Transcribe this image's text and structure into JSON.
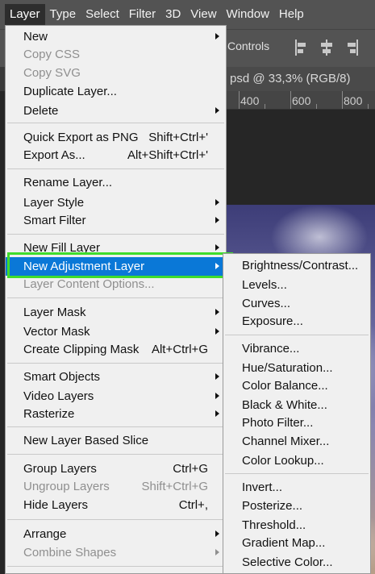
{
  "menubar": {
    "items": [
      {
        "label": "Layer",
        "active": true
      },
      {
        "label": "Type"
      },
      {
        "label": "Select"
      },
      {
        "label": "Filter"
      },
      {
        "label": "3D"
      },
      {
        "label": "View"
      },
      {
        "label": "Window"
      },
      {
        "label": "Help"
      }
    ]
  },
  "options_bar": {
    "controls_label": "Controls"
  },
  "document": {
    "tab_title": "psd @ 33,3% (RGB/8)"
  },
  "ruler": {
    "labels": [
      "400",
      "600",
      "800"
    ]
  },
  "layer_menu": {
    "items": [
      {
        "label": "New",
        "submenu": true
      },
      {
        "label": "Copy CSS",
        "disabled": true
      },
      {
        "label": "Copy SVG",
        "disabled": true
      },
      {
        "label": "Duplicate Layer..."
      },
      {
        "label": "Delete",
        "submenu": true
      },
      {
        "label": "Quick Export as PNG",
        "shortcut": "Shift+Ctrl+'"
      },
      {
        "label": "Export As...",
        "shortcut": "Alt+Shift+Ctrl+'"
      },
      {
        "label": "Rename Layer..."
      },
      {
        "label": "Layer Style",
        "submenu": true
      },
      {
        "label": "Smart Filter",
        "submenu": true
      },
      {
        "label": "New Fill Layer",
        "submenu": true
      },
      {
        "label": "New Adjustment Layer",
        "submenu": true,
        "highlighted": true
      },
      {
        "label": "Layer Content Options...",
        "disabled": true
      },
      {
        "label": "Layer Mask",
        "submenu": true
      },
      {
        "label": "Vector Mask",
        "submenu": true
      },
      {
        "label": "Create Clipping Mask",
        "shortcut": "Alt+Ctrl+G"
      },
      {
        "label": "Smart Objects",
        "submenu": true
      },
      {
        "label": "Video Layers",
        "submenu": true
      },
      {
        "label": "Rasterize",
        "submenu": true
      },
      {
        "label": "New Layer Based Slice"
      },
      {
        "label": "Group Layers",
        "shortcut": "Ctrl+G"
      },
      {
        "label": "Ungroup Layers",
        "shortcut": "Shift+Ctrl+G",
        "disabled": true
      },
      {
        "label": "Hide Layers",
        "shortcut": "Ctrl+,"
      },
      {
        "label": "Arrange",
        "submenu": true
      },
      {
        "label": "Combine Shapes",
        "submenu": true,
        "disabled": true
      }
    ]
  },
  "adjustment_menu": {
    "items": [
      {
        "label": "Brightness/Contrast..."
      },
      {
        "label": "Levels..."
      },
      {
        "label": "Curves..."
      },
      {
        "label": "Exposure..."
      },
      {
        "label": "Vibrance..."
      },
      {
        "label": "Hue/Saturation..."
      },
      {
        "label": "Color Balance..."
      },
      {
        "label": "Black & White..."
      },
      {
        "label": "Photo Filter..."
      },
      {
        "label": "Channel Mixer..."
      },
      {
        "label": "Color Lookup..."
      },
      {
        "label": "Invert..."
      },
      {
        "label": "Posterize..."
      },
      {
        "label": "Threshold..."
      },
      {
        "label": "Gradient Map..."
      },
      {
        "label": "Selective Color..."
      }
    ]
  },
  "colors": {
    "highlight": "#0a78d7",
    "annotation_frame": "#3fdc2c",
    "menu_bg": "#f0f0f0"
  }
}
